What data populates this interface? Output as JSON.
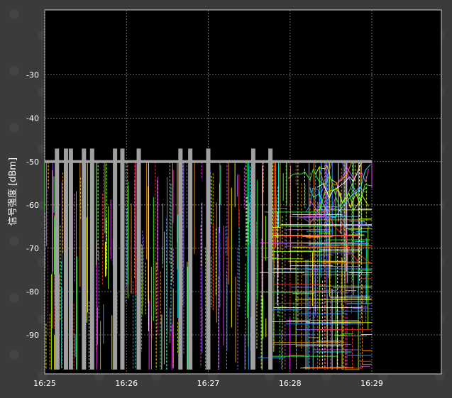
{
  "chart_data": {
    "type": "line",
    "title": "",
    "ylabel": "信号强度 [dBm]",
    "xlabel": "",
    "ylim": [
      -99,
      -15
    ],
    "xlim": [
      0,
      4.85
    ],
    "grid": true,
    "background_color": "#000000",
    "frame_color": "#cfcfcf",
    "grid_color": "#8a8a8a",
    "y_ticks": [
      -30,
      -40,
      -50,
      -60,
      -70,
      -80,
      -90
    ],
    "x_ticks": [
      {
        "value": 0,
        "label": "16:25"
      },
      {
        "value": 1,
        "label": "16:26"
      },
      {
        "value": 2,
        "label": "16:27"
      },
      {
        "value": 3,
        "label": "16:28"
      },
      {
        "value": 4,
        "label": "16:29"
      }
    ],
    "data_end_x": 4.0,
    "signal_max_dbm": -50,
    "signal_floor_dbm": -98,
    "scan_gaps_x": [
      0.15,
      0.26,
      0.32,
      0.48,
      0.58,
      0.86,
      0.95,
      1.15,
      1.66,
      1.78,
      2.0,
      2.55,
      2.76
    ],
    "series_colors": [
      "#ffff00",
      "#ff3030",
      "#30ff30",
      "#40a0ff",
      "#ff40ff",
      "#00ffff",
      "#ff9900",
      "#9966ff",
      "#ffffff",
      "#99ff00"
    ]
  }
}
